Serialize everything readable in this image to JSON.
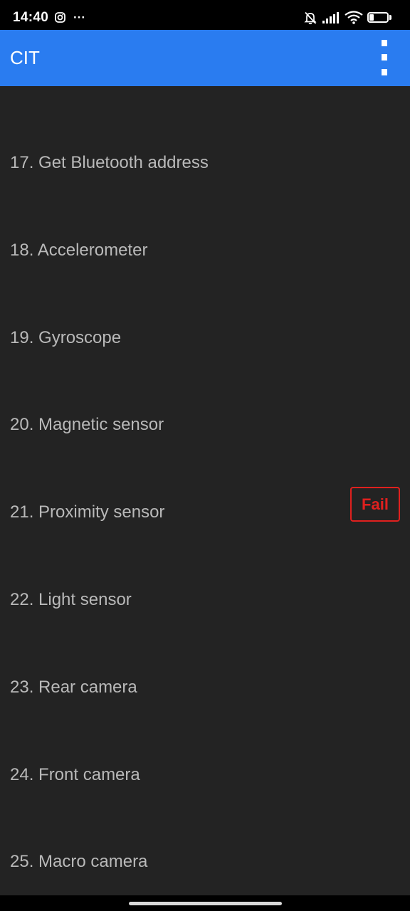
{
  "status_bar": {
    "time": "14:40",
    "battery": "23",
    "battery_level": 0.23,
    "icons": [
      "instagram-icon",
      "more-dots-icon",
      "mute-icon",
      "signal-icon",
      "wifi-icon",
      "battery-icon"
    ]
  },
  "app_bar": {
    "title": "CIT",
    "menu_icon": "overflow-menu-icon"
  },
  "list": {
    "items": [
      {
        "label": "17. Get Bluetooth address",
        "status": ""
      },
      {
        "label": "18. Accelerometer",
        "status": ""
      },
      {
        "label": "19. Gyroscope",
        "status": ""
      },
      {
        "label": "20. Magnetic sensor",
        "status": ""
      },
      {
        "label": "21. Proximity sensor",
        "status": "Fail"
      },
      {
        "label": "22. Light sensor",
        "status": ""
      },
      {
        "label": "23. Rear camera",
        "status": ""
      },
      {
        "label": "24. Front camera",
        "status": ""
      },
      {
        "label": "25. Macro camera",
        "status": ""
      }
    ]
  },
  "colors": {
    "app_bar": "#2a7cf0",
    "background": "#232323",
    "item_text": "#b9b9b9",
    "fail": "#e0201e"
  }
}
